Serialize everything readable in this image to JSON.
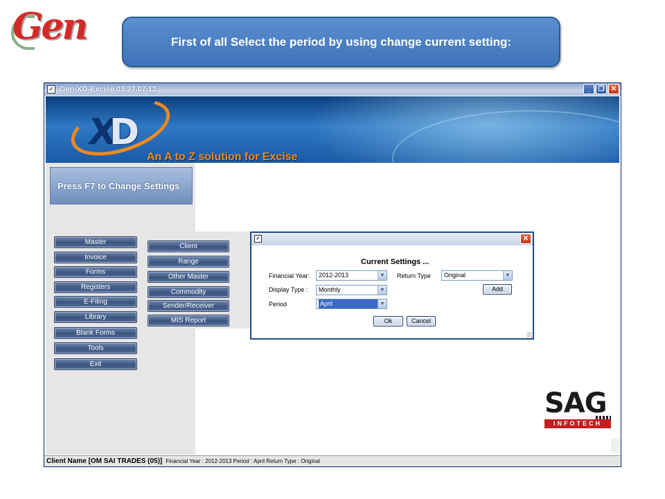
{
  "slide": {
    "logo_text": "Gen",
    "callout": "First of all Select the period by using change current setting:"
  },
  "window": {
    "title": "Gen-XD-Excise 03.27.07.12",
    "buttons": {
      "minimize": "_",
      "restore": "❐",
      "close": "✕"
    }
  },
  "banner": {
    "logo_x": "X",
    "logo_d": "D",
    "tagline": "An A to Z solution for Excise"
  },
  "left_panel": {
    "f7_hint": "Press F7 to Change Settings"
  },
  "main_menu": [
    {
      "label": "Master"
    },
    {
      "label": "Invoice"
    },
    {
      "label": "Forms"
    },
    {
      "label": "Registers"
    },
    {
      "label": "E-Filing"
    },
    {
      "label": "Library"
    },
    {
      "label": "Blank Forms"
    },
    {
      "label": "Tools"
    },
    {
      "label": "Exit"
    }
  ],
  "sub_menu": [
    {
      "label": "Client"
    },
    {
      "label": "Range"
    },
    {
      "label": "Other Master"
    },
    {
      "label": "Commodity"
    },
    {
      "label": "Sender/Receiver"
    },
    {
      "label": "MIS Report"
    }
  ],
  "dialog": {
    "heading": "Current Settings ...",
    "financial_year_label": "Financial Year:",
    "financial_year_value": "2012-2013",
    "display_type_label": "Display Type :",
    "display_type_value": "Monthly",
    "period_label": "Period",
    "period_value": "April",
    "return_type_label": "Return Type",
    "return_type_value": "Original",
    "add_label": "Add",
    "ok_label": "Ok",
    "cancel_label": "Cancel",
    "close_glyph": "✕",
    "arrow_glyph": "▼"
  },
  "sag_logo": {
    "main": "SAG",
    "sub": "INFOTECH"
  },
  "status_bar": {
    "client": "Client Name [OM SAI TRADES  (05)]",
    "details": "Financial Year : 2012-2013  Period : April  Return Type : Original"
  },
  "icons": {
    "app": "app-icon",
    "dropdown": "chevron-down-icon",
    "close": "close-icon"
  },
  "colors": {
    "callout_bg": "#4a80c4",
    "nav_button": "#3c5580",
    "tagline": "#f28a1c",
    "sag_red": "#c41e1e"
  }
}
